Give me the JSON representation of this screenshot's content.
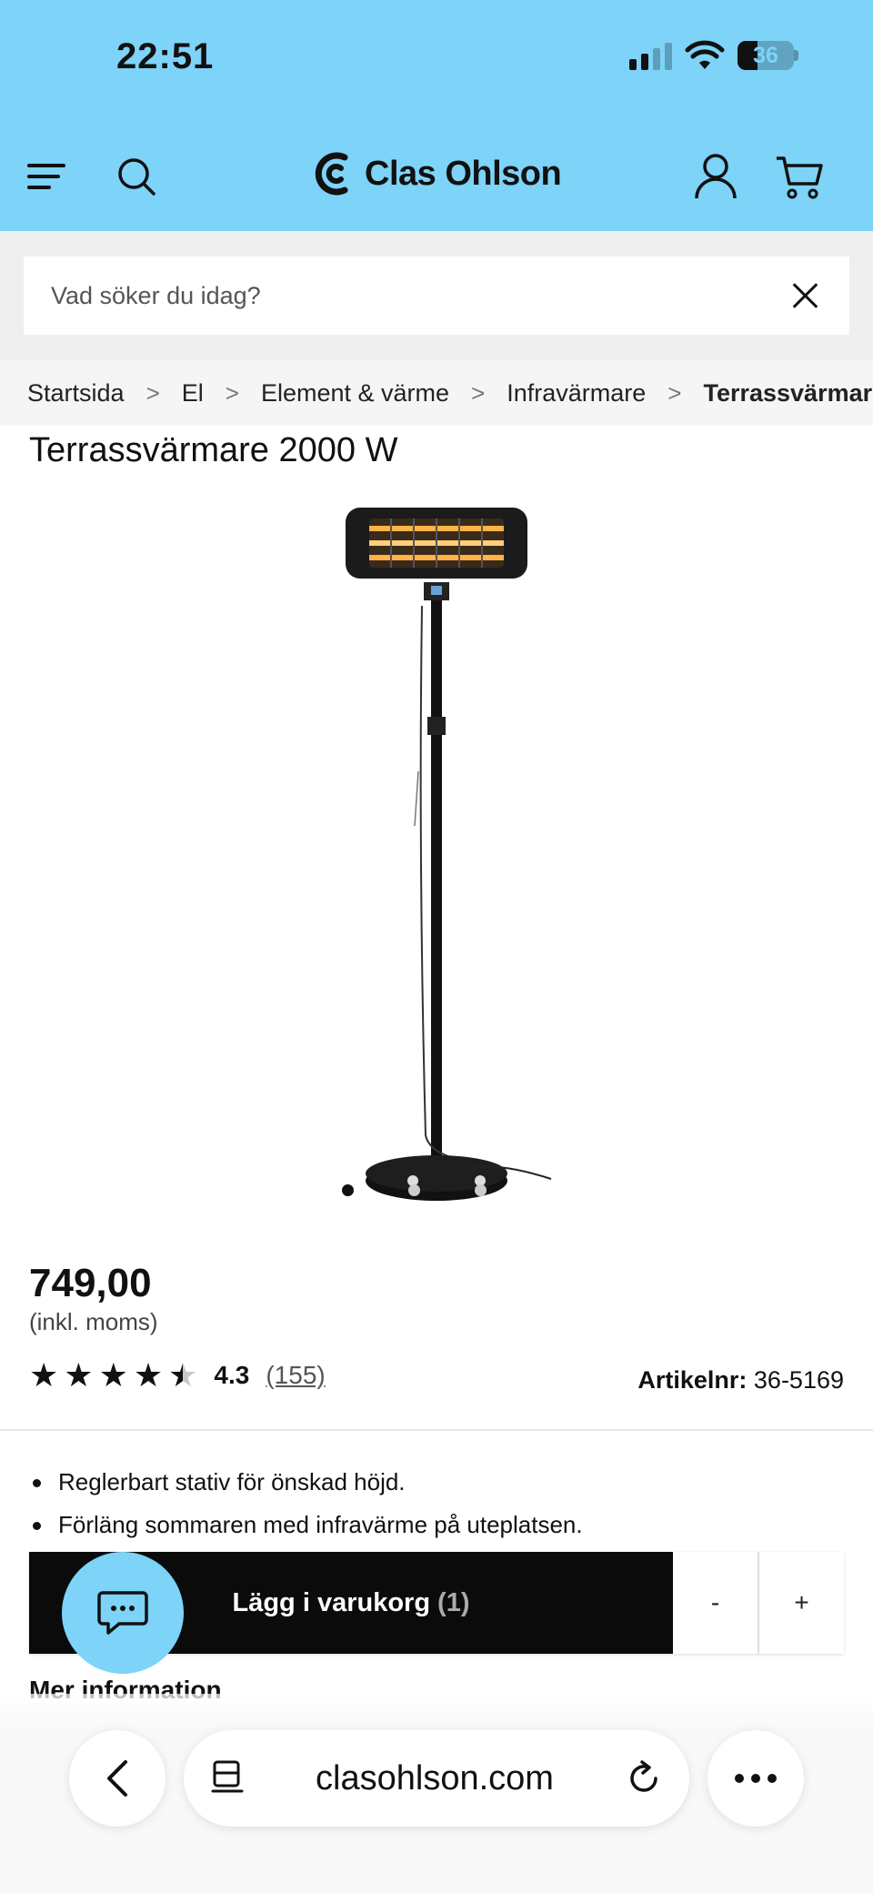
{
  "status_bar": {
    "time": "22:51",
    "battery": "36",
    "battery_level": 0.36
  },
  "header": {
    "logo": "Clas Ohlson",
    "icons": [
      "menu-icon",
      "search-icon",
      "user-icon",
      "cart-icon"
    ],
    "brand_color": "#7dd3f8"
  },
  "search": {
    "placeholder": "Vad söker du idag?"
  },
  "breadcrumb": {
    "items": [
      "Startsida",
      "El",
      "Element & värme",
      "Infravärmare",
      "Terrassvärmare"
    ]
  },
  "product": {
    "title": "Terrassvärmare 2000 W",
    "price": "749,00",
    "vat_note": "(inkl. moms)",
    "rating": 4.3,
    "rating_value": "4.3",
    "review_count": "(155)",
    "article_label": "Artikelnr:",
    "article_number": "36-5169",
    "bullets": [
      "Reglerbart stativ för önskad höjd.",
      "Förläng sommaren med infravärme på uteplatsen."
    ],
    "image_count": 3,
    "active_image": 1
  },
  "cart": {
    "add_label": "Lägg i varukorg",
    "count": "(1)",
    "minus": "-",
    "plus": "+"
  },
  "more_info": "Mer information",
  "browser": {
    "url": "clasohlson.com"
  }
}
